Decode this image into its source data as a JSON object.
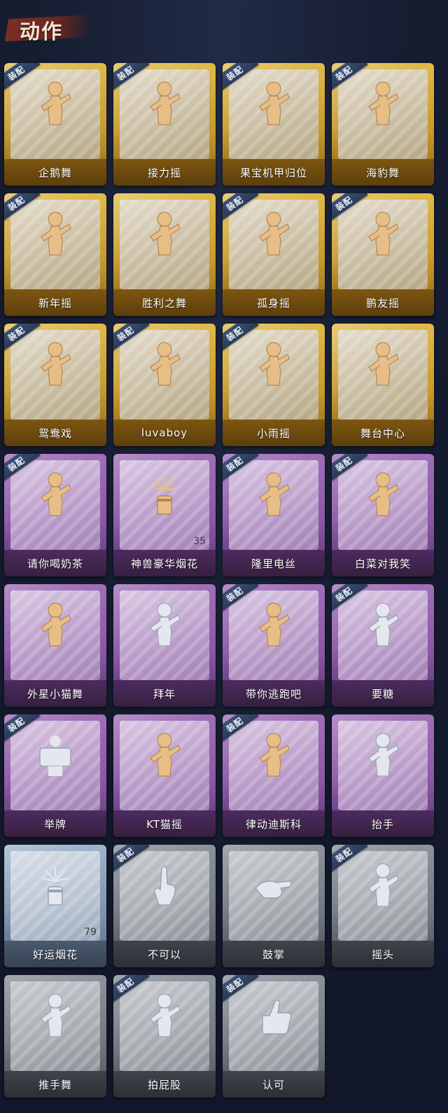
{
  "page": {
    "title": "动作",
    "equipped_badge_label": "装配"
  },
  "colors": {
    "gold_tier": "#d1a636",
    "purple_tier": "#8f5fa9",
    "blue_tier": "#8ea3bc",
    "grey_tier": "#7e848d",
    "badge": "#33466a",
    "figure_gold": "#e7bf86",
    "figure_silver": "#e4e7ee"
  },
  "actions": [
    {
      "name": "企鹅舞",
      "tier": "gold",
      "equipped": true,
      "icon": "figure-gold-icon"
    },
    {
      "name": "接力摇",
      "tier": "gold",
      "equipped": true,
      "icon": "figure-gold-icon"
    },
    {
      "name": "果宝机甲归位",
      "tier": "gold",
      "equipped": true,
      "icon": "figure-gold-icon"
    },
    {
      "name": "海豹舞",
      "tier": "gold",
      "equipped": true,
      "icon": "figure-gold-icon"
    },
    {
      "name": "新年摇",
      "tier": "gold",
      "equipped": true,
      "icon": "figure-gold-icon"
    },
    {
      "name": "胜利之舞",
      "tier": "gold",
      "equipped": false,
      "icon": "figure-gold-icon"
    },
    {
      "name": "孤身摇",
      "tier": "gold",
      "equipped": true,
      "icon": "figure-gold-icon"
    },
    {
      "name": "鹏友摇",
      "tier": "gold",
      "equipped": true,
      "icon": "figure-gold-icon"
    },
    {
      "name": "鸳鸯戏",
      "tier": "gold",
      "equipped": true,
      "icon": "figure-gold-icon"
    },
    {
      "name": "luvaboy",
      "tier": "gold",
      "equipped": true,
      "icon": "figure-gold-icon"
    },
    {
      "name": "小雨摇",
      "tier": "gold",
      "equipped": true,
      "icon": "figure-gold-icon"
    },
    {
      "name": "舞台中心",
      "tier": "gold",
      "equipped": false,
      "icon": "figure-gold-icon"
    },
    {
      "name": "请你喝奶茶",
      "tier": "purple",
      "equipped": true,
      "icon": "figure-gold-icon"
    },
    {
      "name": "神兽豪华烟花",
      "tier": "purple",
      "equipped": false,
      "icon": "firework-gold-icon",
      "count": "35"
    },
    {
      "name": "隆里电丝",
      "tier": "purple",
      "equipped": true,
      "icon": "figure-gold-icon"
    },
    {
      "name": "白菜对我笑",
      "tier": "purple",
      "equipped": true,
      "icon": "figure-gold-icon"
    },
    {
      "name": "外星小猫舞",
      "tier": "purple",
      "equipped": false,
      "icon": "figure-gold-icon"
    },
    {
      "name": "拜年",
      "tier": "purple",
      "equipped": false,
      "icon": "figure-silver-icon"
    },
    {
      "name": "带你逃跑吧",
      "tier": "purple",
      "equipped": true,
      "icon": "figure-gold-icon"
    },
    {
      "name": "要糖",
      "tier": "purple",
      "equipped": true,
      "icon": "figure-silver-icon"
    },
    {
      "name": "举牌",
      "tier": "purple",
      "equipped": true,
      "icon": "sign-silver-icon"
    },
    {
      "name": "KT猫摇",
      "tier": "purple",
      "equipped": false,
      "icon": "figure-gold-icon"
    },
    {
      "name": "律动迪斯科",
      "tier": "purple",
      "equipped": true,
      "icon": "figure-gold-icon"
    },
    {
      "name": "抬手",
      "tier": "purple",
      "equipped": false,
      "icon": "figure-silver-icon"
    },
    {
      "name": "好运烟花",
      "tier": "blue",
      "equipped": false,
      "icon": "firework-silver-icon",
      "count": "79"
    },
    {
      "name": "不可以",
      "tier": "grey",
      "equipped": true,
      "icon": "hand-silver-icon"
    },
    {
      "name": "鼓掌",
      "tier": "grey",
      "equipped": false,
      "icon": "clap-silver-icon"
    },
    {
      "name": "摇头",
      "tier": "grey",
      "equipped": true,
      "icon": "figure-silver-icon"
    },
    {
      "name": "推手舞",
      "tier": "grey",
      "equipped": false,
      "icon": "figure-silver-icon"
    },
    {
      "name": "拍屁股",
      "tier": "grey",
      "equipped": true,
      "icon": "figure-silver-icon"
    },
    {
      "name": "认可",
      "tier": "grey",
      "equipped": true,
      "icon": "thumbs-up-silver-icon"
    }
  ]
}
